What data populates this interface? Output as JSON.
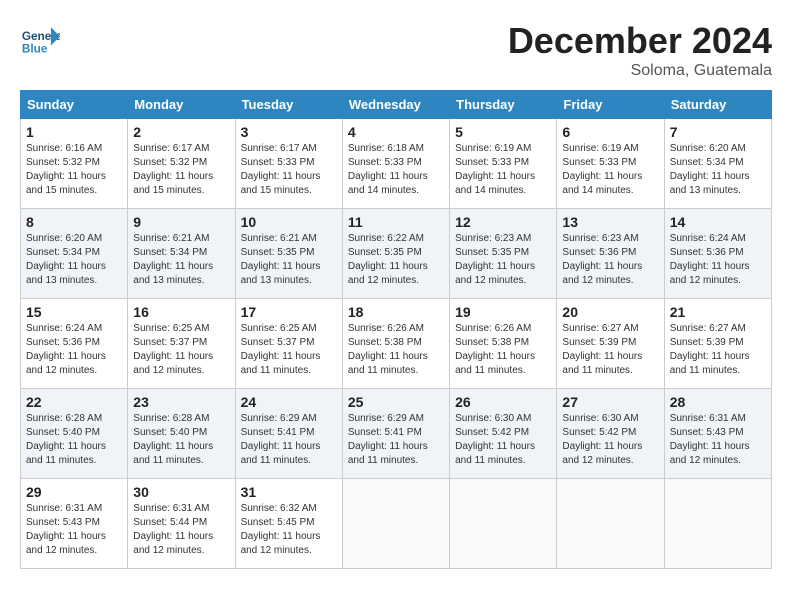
{
  "header": {
    "logo_general": "General",
    "logo_blue": "Blue",
    "month_title": "December 2024",
    "subtitle": "Soloma, Guatemala"
  },
  "days_of_week": [
    "Sunday",
    "Monday",
    "Tuesday",
    "Wednesday",
    "Thursday",
    "Friday",
    "Saturday"
  ],
  "weeks": [
    [
      {
        "day": "1",
        "info": "Sunrise: 6:16 AM\nSunset: 5:32 PM\nDaylight: 11 hours\nand 15 minutes."
      },
      {
        "day": "2",
        "info": "Sunrise: 6:17 AM\nSunset: 5:32 PM\nDaylight: 11 hours\nand 15 minutes."
      },
      {
        "day": "3",
        "info": "Sunrise: 6:17 AM\nSunset: 5:33 PM\nDaylight: 11 hours\nand 15 minutes."
      },
      {
        "day": "4",
        "info": "Sunrise: 6:18 AM\nSunset: 5:33 PM\nDaylight: 11 hours\nand 14 minutes."
      },
      {
        "day": "5",
        "info": "Sunrise: 6:19 AM\nSunset: 5:33 PM\nDaylight: 11 hours\nand 14 minutes."
      },
      {
        "day": "6",
        "info": "Sunrise: 6:19 AM\nSunset: 5:33 PM\nDaylight: 11 hours\nand 14 minutes."
      },
      {
        "day": "7",
        "info": "Sunrise: 6:20 AM\nSunset: 5:34 PM\nDaylight: 11 hours\nand 13 minutes."
      }
    ],
    [
      {
        "day": "8",
        "info": "Sunrise: 6:20 AM\nSunset: 5:34 PM\nDaylight: 11 hours\nand 13 minutes."
      },
      {
        "day": "9",
        "info": "Sunrise: 6:21 AM\nSunset: 5:34 PM\nDaylight: 11 hours\nand 13 minutes."
      },
      {
        "day": "10",
        "info": "Sunrise: 6:21 AM\nSunset: 5:35 PM\nDaylight: 11 hours\nand 13 minutes."
      },
      {
        "day": "11",
        "info": "Sunrise: 6:22 AM\nSunset: 5:35 PM\nDaylight: 11 hours\nand 12 minutes."
      },
      {
        "day": "12",
        "info": "Sunrise: 6:23 AM\nSunset: 5:35 PM\nDaylight: 11 hours\nand 12 minutes."
      },
      {
        "day": "13",
        "info": "Sunrise: 6:23 AM\nSunset: 5:36 PM\nDaylight: 11 hours\nand 12 minutes."
      },
      {
        "day": "14",
        "info": "Sunrise: 6:24 AM\nSunset: 5:36 PM\nDaylight: 11 hours\nand 12 minutes."
      }
    ],
    [
      {
        "day": "15",
        "info": "Sunrise: 6:24 AM\nSunset: 5:36 PM\nDaylight: 11 hours\nand 12 minutes."
      },
      {
        "day": "16",
        "info": "Sunrise: 6:25 AM\nSunset: 5:37 PM\nDaylight: 11 hours\nand 12 minutes."
      },
      {
        "day": "17",
        "info": "Sunrise: 6:25 AM\nSunset: 5:37 PM\nDaylight: 11 hours\nand 11 minutes."
      },
      {
        "day": "18",
        "info": "Sunrise: 6:26 AM\nSunset: 5:38 PM\nDaylight: 11 hours\nand 11 minutes."
      },
      {
        "day": "19",
        "info": "Sunrise: 6:26 AM\nSunset: 5:38 PM\nDaylight: 11 hours\nand 11 minutes."
      },
      {
        "day": "20",
        "info": "Sunrise: 6:27 AM\nSunset: 5:39 PM\nDaylight: 11 hours\nand 11 minutes."
      },
      {
        "day": "21",
        "info": "Sunrise: 6:27 AM\nSunset: 5:39 PM\nDaylight: 11 hours\nand 11 minutes."
      }
    ],
    [
      {
        "day": "22",
        "info": "Sunrise: 6:28 AM\nSunset: 5:40 PM\nDaylight: 11 hours\nand 11 minutes."
      },
      {
        "day": "23",
        "info": "Sunrise: 6:28 AM\nSunset: 5:40 PM\nDaylight: 11 hours\nand 11 minutes."
      },
      {
        "day": "24",
        "info": "Sunrise: 6:29 AM\nSunset: 5:41 PM\nDaylight: 11 hours\nand 11 minutes."
      },
      {
        "day": "25",
        "info": "Sunrise: 6:29 AM\nSunset: 5:41 PM\nDaylight: 11 hours\nand 11 minutes."
      },
      {
        "day": "26",
        "info": "Sunrise: 6:30 AM\nSunset: 5:42 PM\nDaylight: 11 hours\nand 11 minutes."
      },
      {
        "day": "27",
        "info": "Sunrise: 6:30 AM\nSunset: 5:42 PM\nDaylight: 11 hours\nand 12 minutes."
      },
      {
        "day": "28",
        "info": "Sunrise: 6:31 AM\nSunset: 5:43 PM\nDaylight: 11 hours\nand 12 minutes."
      }
    ],
    [
      {
        "day": "29",
        "info": "Sunrise: 6:31 AM\nSunset: 5:43 PM\nDaylight: 11 hours\nand 12 minutes."
      },
      {
        "day": "30",
        "info": "Sunrise: 6:31 AM\nSunset: 5:44 PM\nDaylight: 11 hours\nand 12 minutes."
      },
      {
        "day": "31",
        "info": "Sunrise: 6:32 AM\nSunset: 5:45 PM\nDaylight: 11 hours\nand 12 minutes."
      },
      null,
      null,
      null,
      null
    ]
  ]
}
